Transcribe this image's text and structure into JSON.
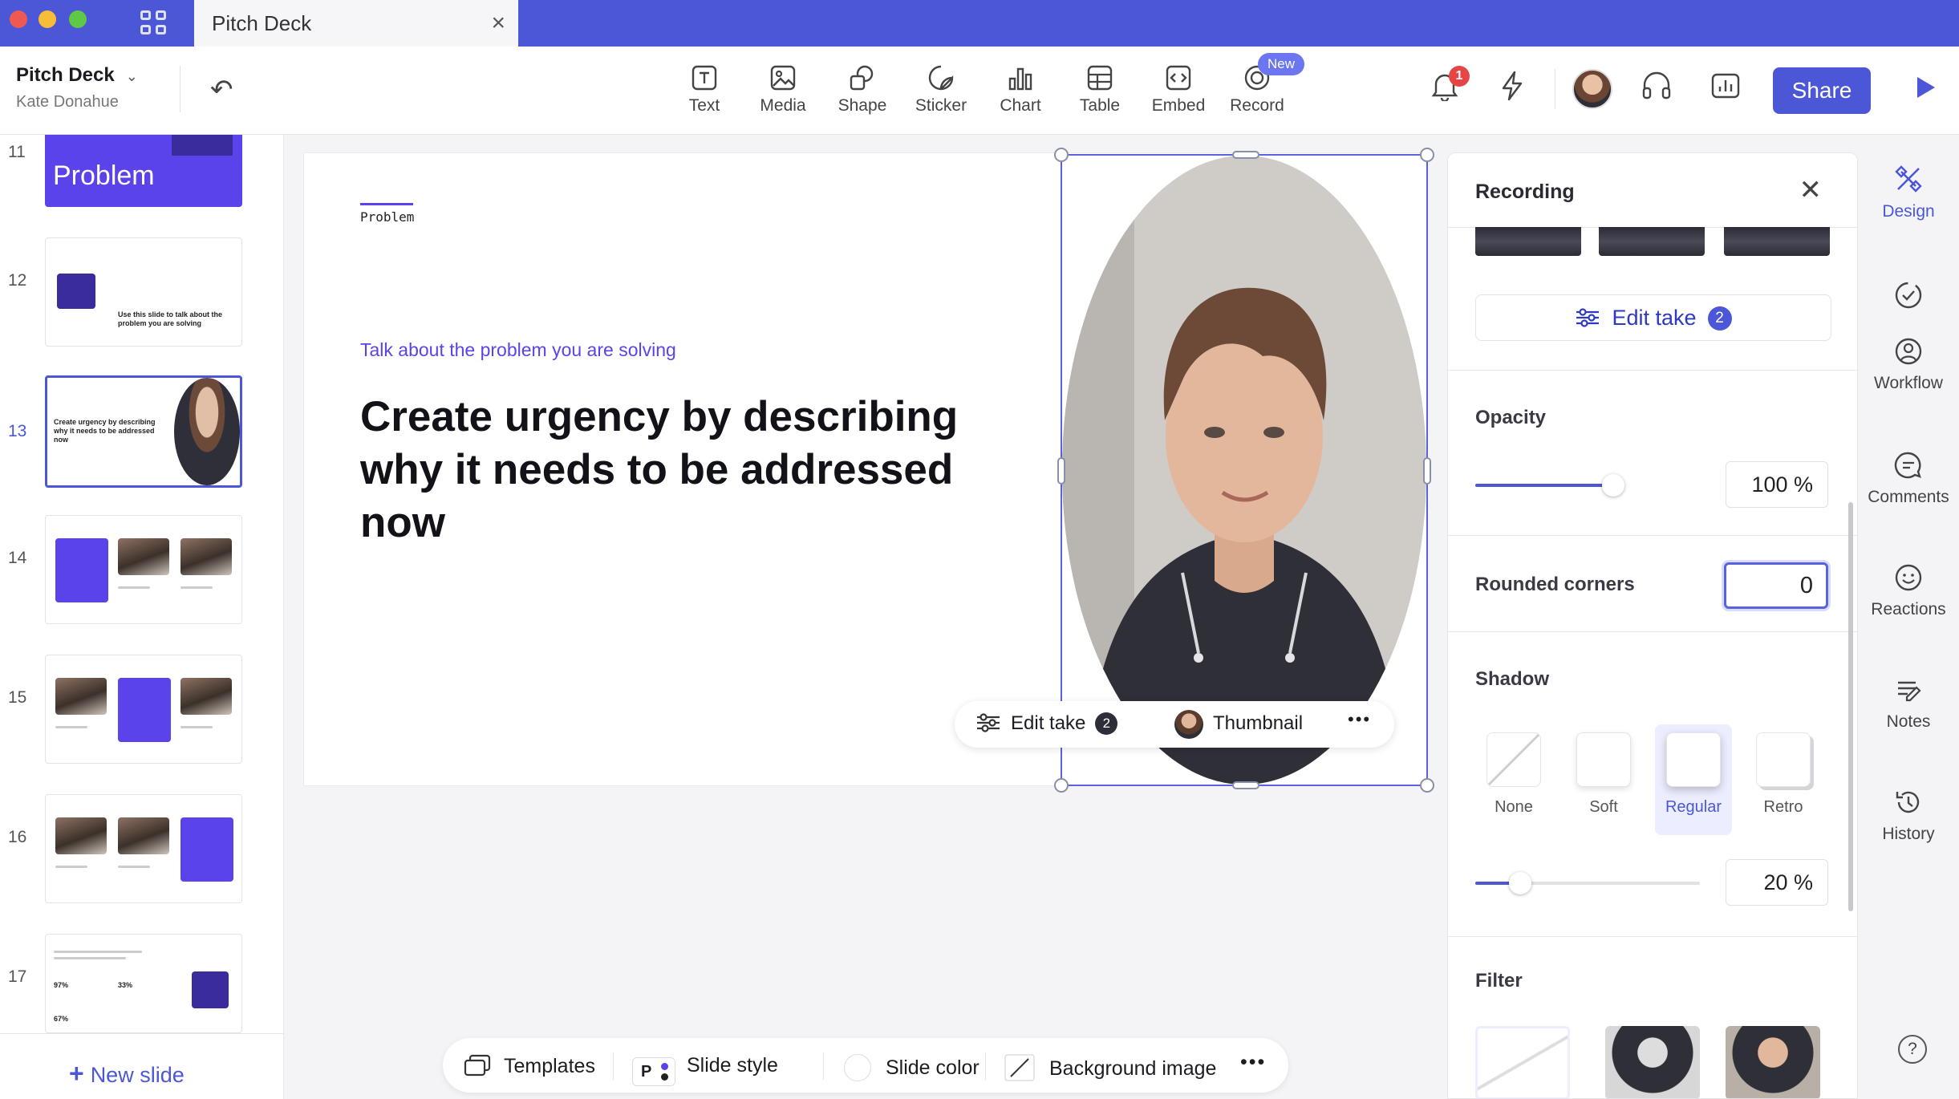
{
  "window": {
    "tab_title": "Pitch Deck",
    "tab_close": "×"
  },
  "header": {
    "doc_title": "Pitch Deck",
    "author": "Kate Donahue",
    "tools": [
      {
        "label": "Text",
        "icon": "text-icon"
      },
      {
        "label": "Media",
        "icon": "media-icon"
      },
      {
        "label": "Shape",
        "icon": "shape-icon"
      },
      {
        "label": "Sticker",
        "icon": "sticker-icon"
      },
      {
        "label": "Chart",
        "icon": "chart-icon"
      },
      {
        "label": "Table",
        "icon": "table-icon"
      },
      {
        "label": "Embed",
        "icon": "embed-icon"
      },
      {
        "label": "Record",
        "icon": "record-icon"
      }
    ],
    "record_badge": "New",
    "notification_count": "1",
    "share_label": "Share"
  },
  "slides_panel": {
    "slides": [
      {
        "number": "11",
        "thumb_text": "Problem"
      },
      {
        "number": "12",
        "thumb_text": "Use this slide to talk about the problem you are solving"
      },
      {
        "number": "13",
        "thumb_text": "Create urgency by describing why it needs to be addressed now",
        "selected": true
      },
      {
        "number": "14",
        "thumb_text": ""
      },
      {
        "number": "15",
        "thumb_text": ""
      },
      {
        "number": "16",
        "thumb_text": ""
      },
      {
        "number": "17",
        "thumb_text": ""
      }
    ],
    "slide17_stats": [
      "97%",
      "33%",
      "67%"
    ],
    "new_slide_label": "New slide"
  },
  "slide": {
    "section": "Problem",
    "subtitle": "Talk about the problem you are solving",
    "title": "Create urgency by describing why it needs to be addressed now",
    "video_bar": {
      "edit_take_label": "Edit take",
      "edit_take_count": "2",
      "thumbnail_label": "Thumbnail",
      "more": "•••"
    }
  },
  "bottom_bar": {
    "templates": "Templates",
    "slide_style": "Slide style",
    "slide_style_letter": "P",
    "slide_color": "Slide color",
    "background_image": "Background image",
    "more": "•••"
  },
  "recording_panel": {
    "title": "Recording",
    "edit_take_label": "Edit take",
    "edit_take_count": "2",
    "opacity": {
      "label": "Opacity",
      "value": "100 %",
      "fraction": 1.0
    },
    "rounded_corners": {
      "label": "Rounded corners",
      "value": "0"
    },
    "shadow": {
      "label": "Shadow",
      "options": [
        "None",
        "Soft",
        "Regular",
        "Retro"
      ],
      "selected": "Regular",
      "value": "20 %",
      "fraction": 0.2
    },
    "filter": {
      "label": "Filter"
    }
  },
  "rail": {
    "items": [
      {
        "label": "Design",
        "icon": "design-icon",
        "active": true
      },
      {
        "label": "",
        "icon": "checklist-icon"
      },
      {
        "label": "Workflow",
        "icon": "workflow-user-icon"
      },
      {
        "label": "Comments",
        "icon": "comment-icon"
      },
      {
        "label": "Reactions",
        "icon": "smiley-icon"
      },
      {
        "label": "Notes",
        "icon": "notes-icon"
      },
      {
        "label": "History",
        "icon": "history-icon"
      }
    ],
    "help": "?"
  },
  "colors": {
    "accent": "#4b57d6",
    "brand_purple": "#5a43ea",
    "titlebar": "#4b57d6"
  }
}
